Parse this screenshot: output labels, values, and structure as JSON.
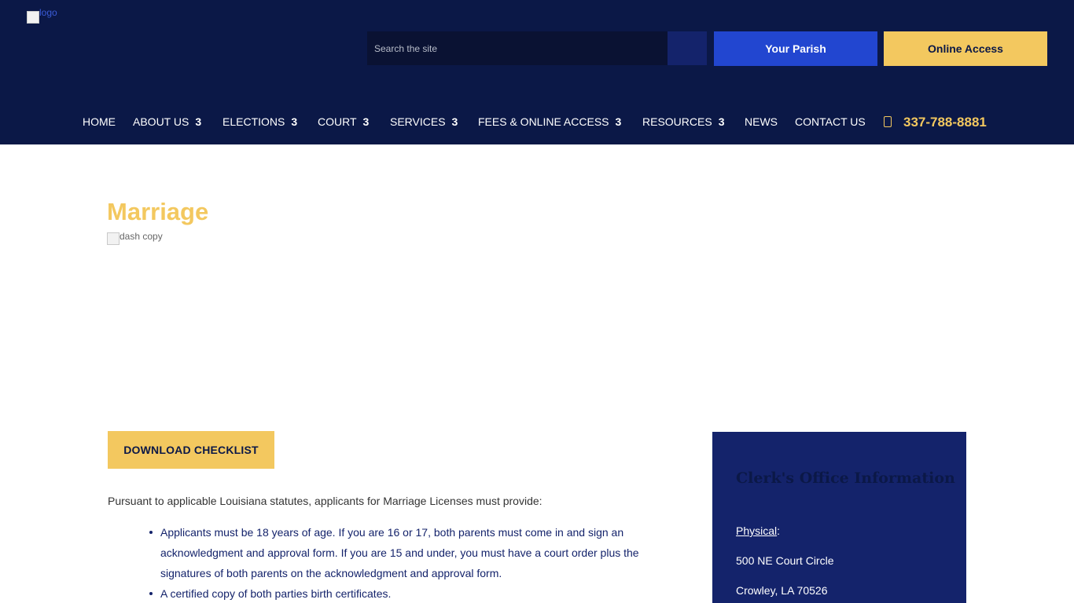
{
  "header": {
    "logo_alt": "logo",
    "search": {
      "placeholder": "Search the site"
    },
    "buttons": {
      "parish": "Your Parish",
      "online": "Online Access"
    },
    "nav": [
      {
        "label": "HOME",
        "caret": ""
      },
      {
        "label": "ABOUT US",
        "caret": "3"
      },
      {
        "label": "ELECTIONS",
        "caret": "3"
      },
      {
        "label": "COURT",
        "caret": "3"
      },
      {
        "label": "SERVICES",
        "caret": "3"
      },
      {
        "label": "FEES & ONLINE ACCESS",
        "caret": "3"
      },
      {
        "label": "RESOURCES",
        "caret": "3"
      },
      {
        "label": "NEWS",
        "caret": ""
      },
      {
        "label": "CONTACT US",
        "caret": ""
      }
    ],
    "phone": "337-788-8881",
    "phone_icon": "phone-icon"
  },
  "main": {
    "title": "Marriage",
    "dash_alt": "dash copy",
    "download_label": "DOWNLOAD CHECKLIST",
    "intro": "Pursuant to applicable Louisiana statutes, applicants for Marriage Licenses must provide:",
    "list": [
      "Applicants must be 18 years of age. If you are 16 or 17, both parents must come in and sign an",
      "acknowledgment and approval form. If you are 15 and under, you must have a court order plus the",
      "signatures of both parents on the acknowledgment and approval form.",
      "A certified copy of both parties birth certificates."
    ]
  },
  "sidebar": {
    "title": "Clerk's Office Information",
    "physical_label": "Physical",
    "physical_suffix": ":",
    "address_line1": "500 NE Court Circle",
    "address_line2": "Crowley, LA 70526"
  },
  "colors": {
    "header_bg": "#0b1847",
    "accent_gold": "#f3c85f",
    "accent_blue": "#2246d0",
    "sidebar_bg": "#14236b"
  }
}
